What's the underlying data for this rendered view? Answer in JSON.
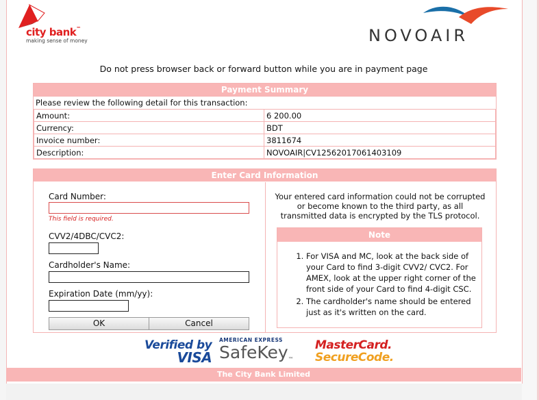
{
  "header": {
    "citybank_name": "city bank",
    "citybank_tm": "™",
    "citybank_tagline": "making sense of money",
    "novoair_name": "NOVOAIR"
  },
  "warning": "Do not press browser back or forward button while you are in payment page",
  "summary": {
    "title": "Payment Summary",
    "intro": "Please review the following detail for this transaction:",
    "rows": [
      {
        "label": "Amount:",
        "value": "6 200.00"
      },
      {
        "label": "Currency:",
        "value": "BDT"
      },
      {
        "label": "Invoice number:",
        "value": "3811674"
      },
      {
        "label": "Description:",
        "value": "NOVOAIR|CV12562017061403109"
      }
    ]
  },
  "card": {
    "title": "Enter Card Information",
    "card_number_label": "Card Number:",
    "card_number_value": "",
    "card_number_error": "This field is required.",
    "cvv_label": "CVV2/4DBC/CVC2:",
    "cvv_value": "",
    "name_label": "Cardholder's Name:",
    "name_value": "",
    "expiry_label": "Expiration Date (mm/yy):",
    "expiry_value": "",
    "ok_label": "OK",
    "cancel_label": "Cancel",
    "info_text": "Your entered card information could not be corrupted or become known to the third party, as all transmitted data is encrypted by the TLS protocol.",
    "note_title": "Note",
    "notes": [
      "For VISA and MC, look at the back side of your Card to find 3-digit CVV2/ CVC2. For AMEX, look at the upper right corner of the front side of your Card to find 4-digit CSC.",
      "The cardholder's name should be entered just as it's written on the card."
    ]
  },
  "badges": {
    "vbv_line1": "Verified by",
    "vbv_line2": "VISA",
    "safekey_line1": "AMERICAN EXPRESS",
    "safekey_line2": "SafeKey",
    "safekey_mark": "™",
    "mc_line1": "MasterCard.",
    "mc_line2": "SecureCode."
  },
  "footer": "The City Bank Limited",
  "colors": {
    "accent_pink": "#f9b6b6",
    "citybank_red": "#e02020",
    "novo_blue": "#1a6fa8",
    "error_red": "#d62020"
  }
}
